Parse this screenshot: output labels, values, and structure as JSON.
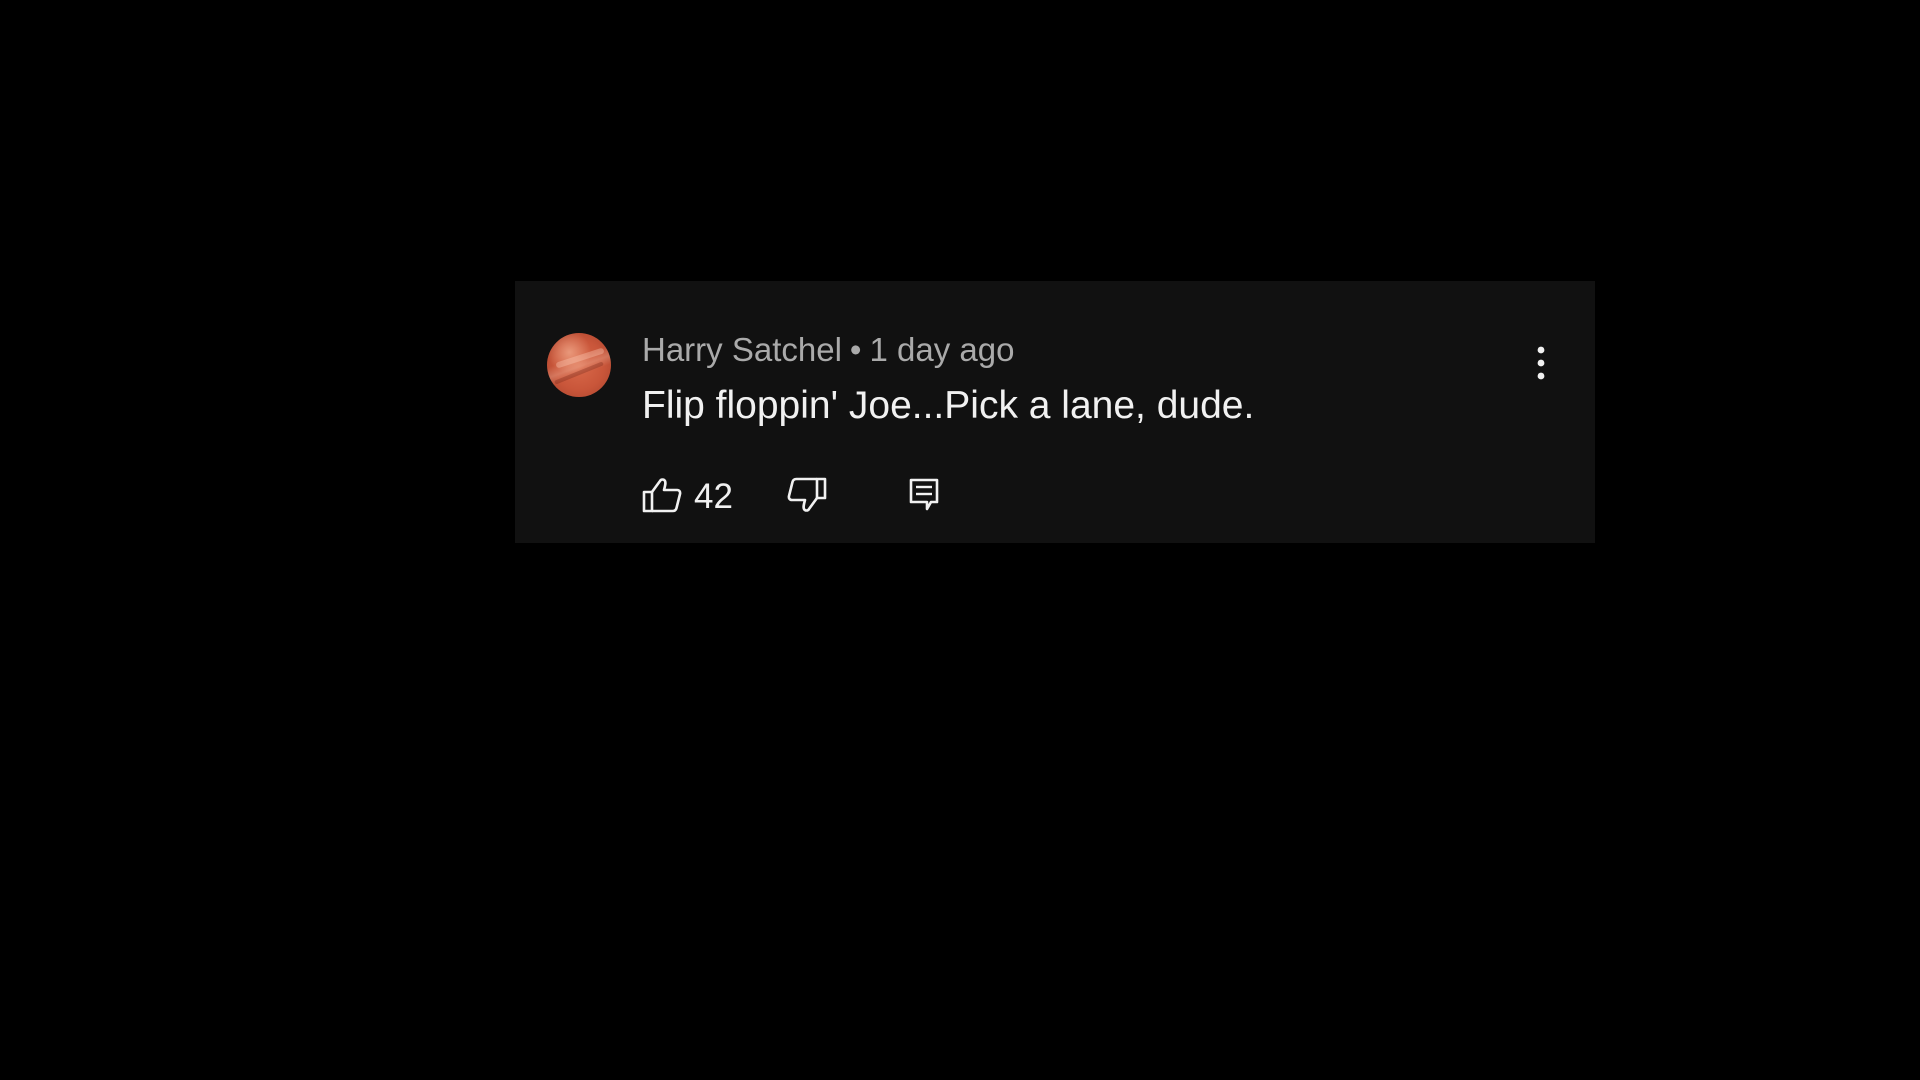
{
  "comment": {
    "author": "Harry Satchel",
    "separator": "•",
    "timestamp": "1 day ago",
    "text": "Flip floppin' Joe...Pick a lane, dude.",
    "like_count": "42",
    "avatar_color": "#c9563a"
  },
  "icons": {
    "like": "thumbs-up-icon",
    "dislike": "thumbs-down-icon",
    "reply": "reply-comment-icon",
    "menu": "more-vertical-icon"
  },
  "colors": {
    "background": "#000000",
    "card": "#111111",
    "meta_text": "#aaaaaa",
    "primary_text": "#f1f1f1"
  }
}
